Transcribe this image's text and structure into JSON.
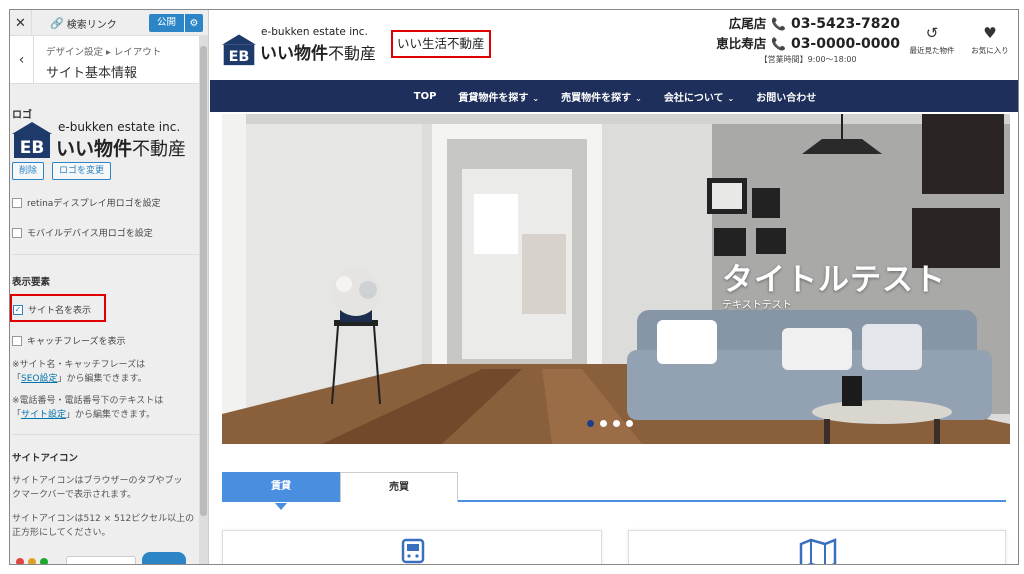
{
  "customizer": {
    "close_label": "✕",
    "search_link_label": "検索リンク",
    "publish_label": "公開",
    "breadcrumb": "デザイン設定 ▸ レイアウト",
    "section_title": "サイト基本情報",
    "logo_heading": "ロゴ",
    "delete_button": "削除",
    "change_logo_button": "ロゴを変更",
    "retina_label": "retinaディスプレイ用ロゴを設定",
    "mobile_label": "モバイルデバイス用ロゴを設定",
    "display_heading": "表示要素",
    "show_site_name_label": "サイト名を表示",
    "show_catchphrase_label": "キャッチフレーズを表示",
    "note1_line1": "※サイト名・キャッチフレーズは",
    "note1_link": "SEO設定",
    "note1_line2_pre": "「",
    "note1_line2_post": "」から編集できます。",
    "note2_line1": "※電話番号・電話番号下のテキストは",
    "note2_link": "サイト設定",
    "note2_line2_post": "」から編集できます。",
    "site_icon_heading": "サイトアイコン",
    "site_icon_desc1": "サイトアイコンはブラウザーのタブやブッ",
    "site_icon_desc2": "クマークバーで表示されます。",
    "site_icon_size1": "サイトアイコンは512 × 512ピクセル以上の",
    "site_icon_size2": "正方形にしてください。"
  },
  "logo": {
    "mark_text": "EB",
    "company_en": "e-bukken estate inc.",
    "name_bold": "いい物件",
    "name_rest": "不動産"
  },
  "header": {
    "tagline": "いい生活不動産",
    "phones": [
      {
        "branch": "広尾店",
        "number": "03-5423-7820"
      },
      {
        "branch": "恵比寿店",
        "number": "03-0000-0000"
      }
    ],
    "hours": "【営業時間】9:00～18:00",
    "recent_label": "最近見た物件",
    "favorites_label": "お気に入り"
  },
  "nav": {
    "items": [
      "TOP",
      "賃貸物件を探す",
      "売買物件を探す",
      "会社について",
      "お問い合わせ"
    ]
  },
  "hero": {
    "title": "タイトルテスト",
    "subtitle": "テキストテスト"
  },
  "tabs": {
    "rent": "賃貸",
    "sale": "売買"
  },
  "colors": {
    "accent": "#2b85c6",
    "nav_bg": "#1d2f5a",
    "logo_navy": "#1e3a6a",
    "highlight_red": "#e00000",
    "tab_blue": "#4a8ee0"
  }
}
